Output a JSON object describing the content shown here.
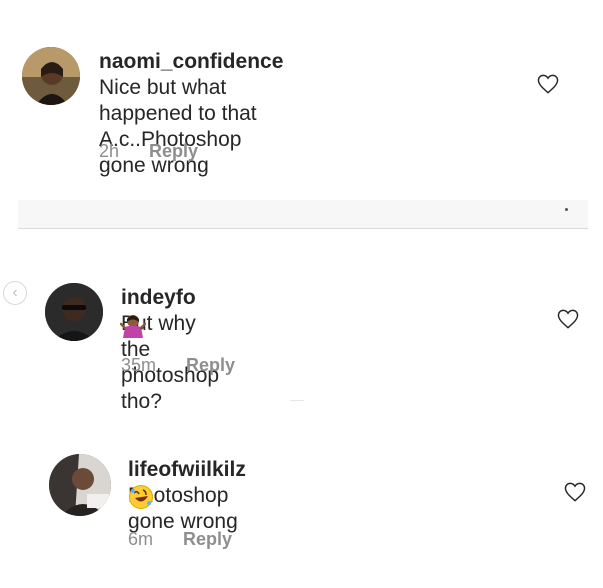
{
  "comments": [
    {
      "username": "naomi_confidence",
      "text_line1": " Nice but what",
      "text_line2": "happened to that A.c..Photoshop",
      "text_line3": "gone wrong",
      "time": "2h",
      "reply": "Reply"
    },
    {
      "username": "indeyfo",
      "text": " But why the photoshop tho?",
      "emoji": "shrug-emoji",
      "time": "35m",
      "reply": "Reply"
    },
    {
      "username": "lifeofwiilkilz",
      "text": " Photoshop gone wrong",
      "emoji": "rolling-laughing-emoji",
      "time": "6m",
      "reply": "Reply"
    }
  ],
  "icons": {
    "like": "heart-outline-icon",
    "back": "chevron-left-icon"
  },
  "colors": {
    "text": "#262626",
    "meta": "#8e8e8e",
    "divider": "#dbdbdb"
  }
}
